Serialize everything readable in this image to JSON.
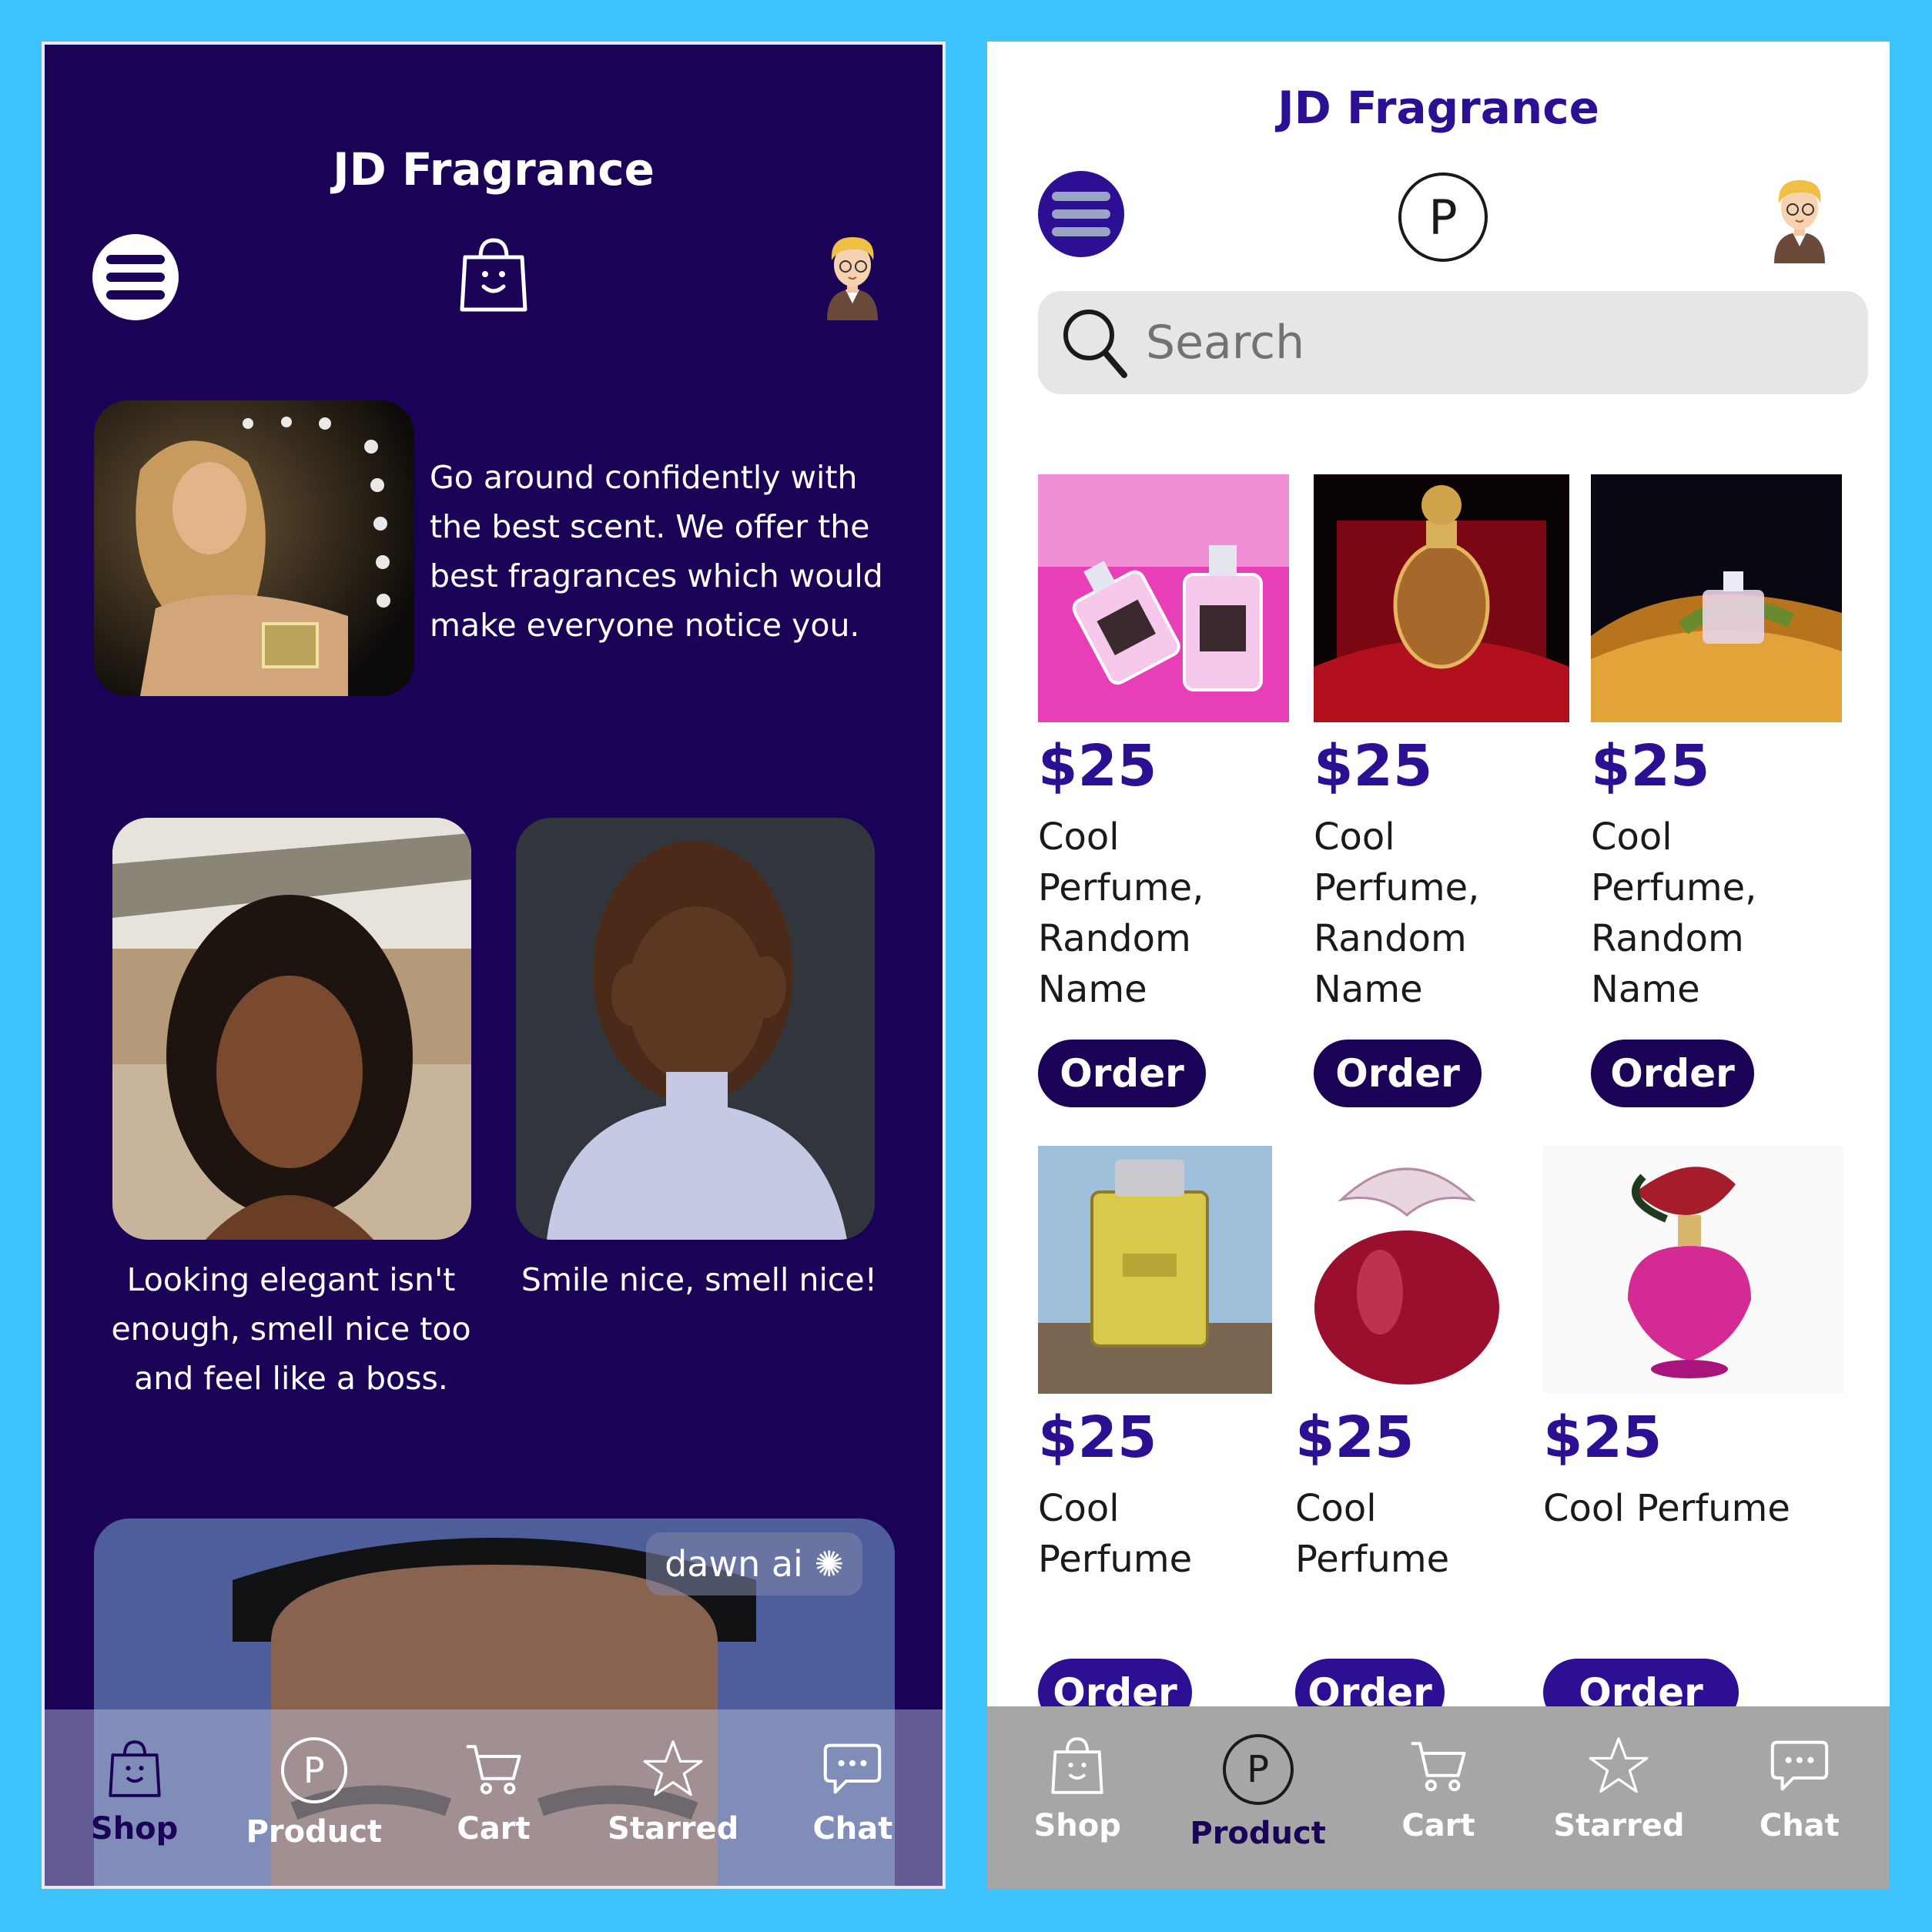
{
  "app": {
    "title": "JD Fragrance"
  },
  "left": {
    "hero_text": "Go around confidently with the best scent. We offer the best fragrances which would make everyone notice you.",
    "cards": [
      {
        "caption": "Looking elegant isn't enough, smell nice too and feel like a boss."
      },
      {
        "caption": "Smile nice, smell nice!"
      }
    ],
    "watermark": "dawn ai"
  },
  "right": {
    "top_center_icon_letter": "P",
    "search": {
      "placeholder": "Search"
    },
    "products": [
      {
        "price": "$25",
        "name": "Cool Perfume, Random Name",
        "order": "Order"
      },
      {
        "price": "$25",
        "name": "Cool Perfume, Random Name",
        "order": "Order"
      },
      {
        "price": "$25",
        "name": "Cool Perfume, Random Name",
        "order": "Order"
      },
      {
        "price": "$25",
        "name": "Cool Perfume",
        "order": "Order"
      },
      {
        "price": "$25",
        "name": "Cool Perfume",
        "order": "Order"
      },
      {
        "price": "$25",
        "name": "Cool Perfume",
        "order": "Order"
      }
    ]
  },
  "tabs": {
    "shop": "Shop",
    "product": "Product",
    "product_icon_letter": "P",
    "cart": "Cart",
    "starred": "Starred",
    "chat": "Chat"
  },
  "colors": {
    "page_background": "#3fc3fd",
    "left_background": "#1a0357",
    "brand_purple": "#2c0f92",
    "order_dark": "#1a0357",
    "tabbar_gray": "#a6a6a6"
  },
  "icons": {
    "menu": "hamburger-menu-icon",
    "bag": "shopping-bag-icon",
    "avatar": "avatar-icon",
    "product": "p-circle-icon",
    "cart": "cart-icon",
    "star": "star-icon",
    "chat": "chat-icon",
    "search": "search-icon"
  }
}
